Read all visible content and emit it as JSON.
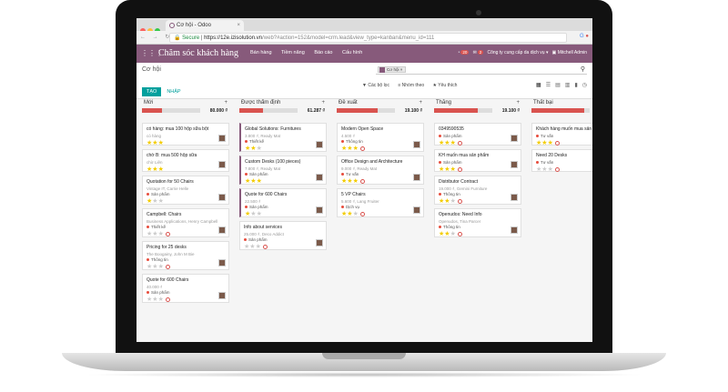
{
  "browser": {
    "tab_title": "Cơ hội - Odoo",
    "secure_label": "Secure",
    "url_domain": "https://12e.izisolution.vn",
    "url_path": "/web?#action=152&model=crm.lead&view_type=kanban&menu_id=111",
    "nav": "← → ↻"
  },
  "odoo": {
    "app_name": "Chăm sóc khách hàng",
    "menu": [
      "Bán hàng",
      "Tiềm năng",
      "Báo cáo",
      "Cấu hình"
    ],
    "company": "Công ty cung cấp da dịch vụ",
    "user": "Mitchell Admin",
    "badge1": "20",
    "badge2": "2"
  },
  "control": {
    "breadcrumb": "Cơ hội",
    "facet": "Cơ hội",
    "create_label": "TẠO",
    "import_label": "NHẬP",
    "filters_label": "▼ Các bộ lọc",
    "group_label": "≡ Nhóm theo",
    "fav_label": "★ Yêu thích"
  },
  "columns": [
    {
      "name": "Mới",
      "amount": "80.000 ₫",
      "fill": 0.35,
      "cards": [
        {
          "title": "có hàng: mua 100 hộp sữa bột",
          "sub": "có hàng",
          "tag": "",
          "stars": 3
        },
        {
          "title": "chờ B: mua 500 hộp sữa",
          "sub": "chờ Liên",
          "tag": "",
          "stars": 3
        },
        {
          "title": "Quotation for 50 Chairs",
          "sub": "Vintage IT, Carrie Helle",
          "tag": "Sản phẩm",
          "stars": 1
        },
        {
          "title": "Campbell: Chairs",
          "sub": "Business Applications, Henry Campbell",
          "tag": "Thiết kế",
          "stars": 0
        },
        {
          "title": "Pricing for 25 desks",
          "sub": "The Boogainy, John M Bie",
          "tag": "Thông tin",
          "stars": 0
        },
        {
          "title": "Quote for 600 Chairs",
          "sub": "40.000 ₫",
          "tag": "Sản phẩm",
          "stars": 0
        }
      ]
    },
    {
      "name": "Được thẩm định",
      "amount": "61.287 ₫",
      "fill": 0.4,
      "cards": [
        {
          "title": "Global Solutions: Furnitures",
          "sub": "3.800 ₫, Ready Mat",
          "tag": "Thiết kế",
          "stars": 2
        },
        {
          "title": "Custom Desks (100 pieces)",
          "sub": "7.800 ₫, Ready Mat",
          "tag": "Sản phẩm",
          "stars": 3
        },
        {
          "title": "Quote for 600 Chairs",
          "sub": "22.500 ₫",
          "tag": "Sản phẩm",
          "stars": 1
        },
        {
          "title": "Info about services",
          "sub": "25.000 ₫, Deco Addict",
          "tag": "Sản phẩm",
          "stars": 0
        }
      ]
    },
    {
      "name": "Đề xuất",
      "amount": "19.100 ₫",
      "fill": 0.7,
      "cards": [
        {
          "title": "Modern Open Space",
          "sub": "4.500 ₫",
          "tag": "Thông tin",
          "stars": 3
        },
        {
          "title": "Office Design and Architecture",
          "sub": "9.000 ₫, Ready Mat",
          "tag": "Tư vấn",
          "stars": 3
        },
        {
          "title": "5 VP Chairs",
          "sub": "5.600 ₫, Lang Fruiter",
          "tag": "Dịch vụ",
          "stars": 2
        }
      ]
    },
    {
      "name": "Thắng",
      "amount": "19.100 ₫",
      "fill": 0.75,
      "cards": [
        {
          "title": "0349590535",
          "sub": "",
          "tag": "Sản phẩm",
          "stars": 3
        },
        {
          "title": "KH muốn mua sản phẩm",
          "sub": "",
          "tag": "Sản phẩm",
          "stars": 3
        },
        {
          "title": "Distributor Contract",
          "sub": "19.000 ₫, Gemini Furniture",
          "tag": "Thông tin",
          "stars": 2
        },
        {
          "title": "Openudos: Need Info",
          "sub": "Openudos, Tina Parcer",
          "tag": "Thông tin",
          "stars": 2
        }
      ]
    },
    {
      "name": "Thất bại",
      "amount": "",
      "fill": 0.9,
      "cards": [
        {
          "title": "Khách hàng muốn mua sản phẩ",
          "sub": "",
          "tag": "Tư vấn",
          "stars": 3
        },
        {
          "title": "Need 20 Desks",
          "sub": "",
          "tag": "Tư vấn",
          "stars": 0
        }
      ]
    }
  ]
}
